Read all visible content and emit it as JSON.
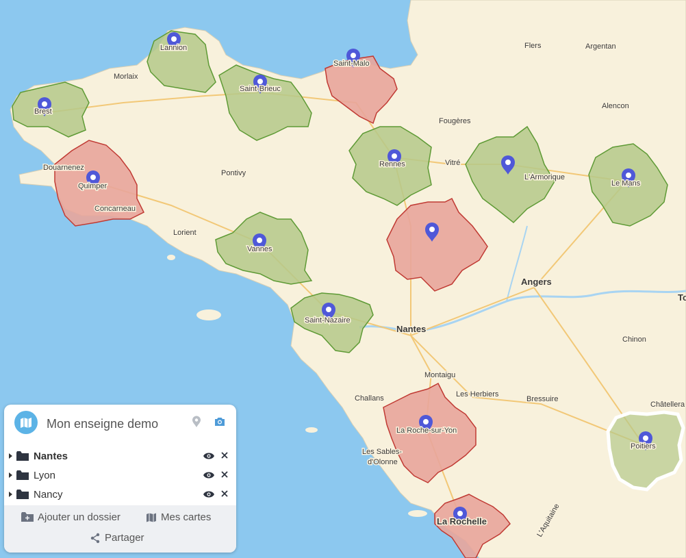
{
  "panel": {
    "title": "Mon enseigne demo",
    "folders": [
      {
        "label": "Nantes",
        "active": true
      },
      {
        "label": "Lyon",
        "active": false
      },
      {
        "label": "Nancy",
        "active": false
      }
    ],
    "add_folder_label": "Ajouter un dossier",
    "my_maps_label": "Mes cartes",
    "share_label": "Partager"
  },
  "map": {
    "colors": {
      "sea": "#8cc8ef",
      "land": "#f8f1dc",
      "zone_green": "#b5c98a",
      "zone_green_border": "#5e9a35",
      "zone_red": "#e8a59b",
      "zone_red_border": "#c03a33",
      "marker": "#4f58d8",
      "highlight_border": "#ffffff"
    },
    "cities": {
      "lannion": "Lannion",
      "morlaix": "Morlaix",
      "saint_malo": "Saint-Malo",
      "saint_brieuc": "Saint-Brieuc",
      "brest": "Brest",
      "flers": "Flers",
      "argentan": "Argentan",
      "alencon": "Alencon",
      "fougeres": "Fougères",
      "douarnenez": "Douarnenez",
      "quimper": "Quimper",
      "concarneau": "Concarneau",
      "pontivy": "Pontivy",
      "rennes": "Rennes",
      "vitre": "Vitré",
      "le_mans": "Le Mans",
      "l_armorique": "L'Armorique",
      "lorient": "Lorient",
      "vannes": "Vannes",
      "angers": "Angers",
      "to": "To",
      "saint_nazaire": "Saint-Nazaire",
      "nantes": "Nantes",
      "chinon": "Chinon",
      "montaigu": "Montaigu",
      "challans": "Challans",
      "les_herbiers": "Les Herbiers",
      "bressuire": "Bressuire",
      "chatellerault": "Châtellera",
      "la_roche_sur_yon": "La Roche-sur-Yon",
      "les_sables_1": "Les Sables-",
      "les_sables_2": "d'Olonne",
      "poitiers": "Poitiers",
      "la_rochelle": "La Rochelle",
      "l_aquitaine": "L'Aquitaine"
    }
  }
}
